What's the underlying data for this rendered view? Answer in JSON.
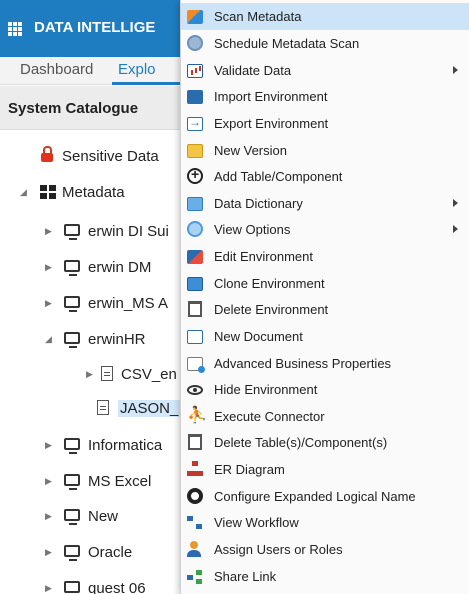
{
  "header": {
    "app_title": "DATA INTELLIGE",
    "grid_icon": "apps-grid-icon"
  },
  "tabs": [
    {
      "label": "Dashboard"
    },
    {
      "label": "Explo"
    }
  ],
  "catalogue": {
    "title": "System Catalogue"
  },
  "tree": {
    "sensitive": "Sensitive Data",
    "metadata": "Metadata",
    "items": [
      {
        "label": "erwin DI Sui"
      },
      {
        "label": "erwin DM"
      },
      {
        "label": "erwin_MS A"
      },
      {
        "label": "erwinHR"
      },
      {
        "label": "CSV_en"
      },
      {
        "label": "JASON_"
      },
      {
        "label": "Informatica"
      },
      {
        "label": "MS Excel"
      },
      {
        "label": "New"
      },
      {
        "label": "Oracle"
      },
      {
        "label": "quest 06"
      }
    ]
  },
  "context_menu": {
    "items": [
      {
        "label": "Scan Metadata",
        "icon": "scan-metadata-icon",
        "highlighted": true
      },
      {
        "label": "Schedule Metadata Scan",
        "icon": "clock-icon"
      },
      {
        "label": "Validate Data",
        "icon": "bar-chart-icon",
        "submenu": true
      },
      {
        "label": "Import Environment",
        "icon": "import-icon"
      },
      {
        "label": "Export Environment",
        "icon": "export-icon"
      },
      {
        "label": "New Version",
        "icon": "new-version-icon"
      },
      {
        "label": "Add Table/Component",
        "icon": "plus-circle-icon"
      },
      {
        "label": "Data Dictionary",
        "icon": "book-icon",
        "submenu": true
      },
      {
        "label": "View Options",
        "icon": "view-options-icon",
        "submenu": true
      },
      {
        "label": "Edit Environment",
        "icon": "edit-icon"
      },
      {
        "label": "Clone Environment",
        "icon": "clone-icon"
      },
      {
        "label": "Delete Environment",
        "icon": "trash-icon"
      },
      {
        "label": "New Document",
        "icon": "new-document-icon"
      },
      {
        "label": "Advanced Business Properties",
        "icon": "advanced-properties-icon"
      },
      {
        "label": "Hide Environment",
        "icon": "eye-icon"
      },
      {
        "label": "Execute Connector",
        "icon": "run-icon"
      },
      {
        "label": "Delete Table(s)/Component(s)",
        "icon": "trash-icon"
      },
      {
        "label": "ER Diagram",
        "icon": "er-diagram-icon"
      },
      {
        "label": "Configure Expanded Logical Name",
        "icon": "gear-icon"
      },
      {
        "label": "View Workflow",
        "icon": "workflow-icon"
      },
      {
        "label": "Assign Users or Roles",
        "icon": "user-icon"
      },
      {
        "label": "Share Link",
        "icon": "share-icon"
      }
    ]
  },
  "colors": {
    "header_blue": "#1e7dc1",
    "menu_highlight": "#cde3f7",
    "lock_red": "#e0331e"
  }
}
